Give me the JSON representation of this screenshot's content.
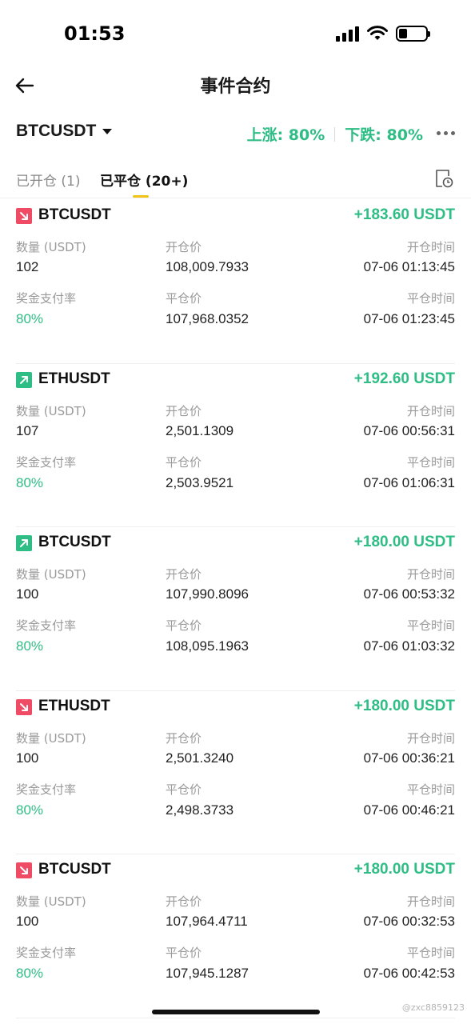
{
  "status_bar": {
    "time": "01:53"
  },
  "nav": {
    "title": "事件合约"
  },
  "symbol_bar": {
    "symbol": "BTCUSDT",
    "up_rate": "上涨: 80%",
    "down_rate": "下跌: 80%"
  },
  "tabs": {
    "open": "已开仓 (1)",
    "closed": "已平仓 (20+)"
  },
  "labels": {
    "quantity": "数量 (USDT)",
    "open_price": "开仓价",
    "open_time": "开仓时间",
    "payout_rate": "奖金支付率",
    "close_price": "平仓价",
    "close_time": "平仓时间"
  },
  "positions": [
    {
      "symbol": "BTCUSDT",
      "direction": "down",
      "pnl": "+183.60 USDT",
      "quantity": "102",
      "open_price": "108,009.7933",
      "open_time": "07-06 01:13:45",
      "payout_rate": "80%",
      "close_price": "107,968.0352",
      "close_time": "07-06 01:23:45"
    },
    {
      "symbol": "ETHUSDT",
      "direction": "up",
      "pnl": "+192.60 USDT",
      "quantity": "107",
      "open_price": "2,501.1309",
      "open_time": "07-06 00:56:31",
      "payout_rate": "80%",
      "close_price": "2,503.9521",
      "close_time": "07-06 01:06:31"
    },
    {
      "symbol": "BTCUSDT",
      "direction": "up",
      "pnl": "+180.00 USDT",
      "quantity": "100",
      "open_price": "107,990.8096",
      "open_time": "07-06 00:53:32",
      "payout_rate": "80%",
      "close_price": "108,095.1963",
      "close_time": "07-06 01:03:32"
    },
    {
      "symbol": "ETHUSDT",
      "direction": "down",
      "pnl": "+180.00 USDT",
      "quantity": "100",
      "open_price": "2,501.3240",
      "open_time": "07-06 00:36:21",
      "payout_rate": "80%",
      "close_price": "2,498.3733",
      "close_time": "07-06 00:46:21"
    },
    {
      "symbol": "BTCUSDT",
      "direction": "down",
      "pnl": "+180.00 USDT",
      "quantity": "100",
      "open_price": "107,964.4711",
      "open_time": "07-06 00:32:53",
      "payout_rate": "80%",
      "close_price": "107,945.1287",
      "close_time": "07-06 00:42:53"
    }
  ],
  "watermark": "@zxc8859123",
  "colors": {
    "green": "#2ebd85",
    "red": "#ef4b65",
    "tab_underline": "#f0c419"
  }
}
